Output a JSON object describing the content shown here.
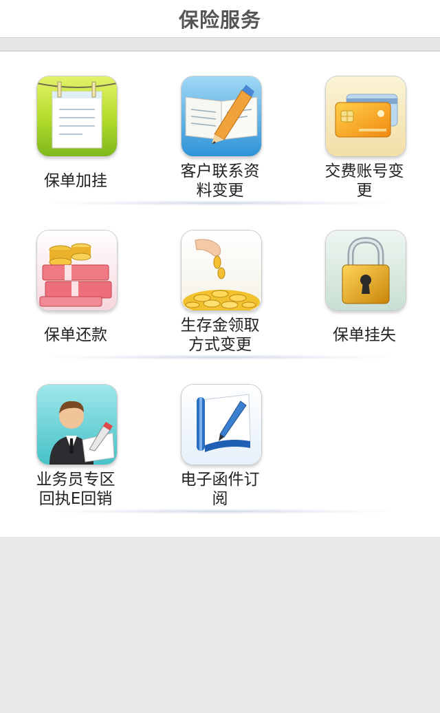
{
  "header": {
    "title": "保险服务"
  },
  "services": [
    {
      "label_lines": [
        "保单加挂"
      ],
      "icon": "notepad-icon"
    },
    {
      "label_lines": [
        "客户联系资",
        "料变更"
      ],
      "icon": "notebook-pencil-icon"
    },
    {
      "label_lines": [
        "交费账号变",
        "更"
      ],
      "icon": "bank-card-icon"
    },
    {
      "label_lines": [
        "保单还款"
      ],
      "icon": "money-coins-icon"
    },
    {
      "label_lines": [
        "生存金领取",
        "方式变更"
      ],
      "icon": "gold-coins-hand-icon"
    },
    {
      "label_lines": [
        "保单挂失"
      ],
      "icon": "padlock-icon"
    },
    {
      "label_lines": [
        "业务员专区",
        "回执E回销"
      ],
      "icon": "agent-avatar-icon"
    },
    {
      "label_lines": [
        "电子函件订",
        "阅"
      ],
      "icon": "document-pen-icon"
    }
  ],
  "colors": {
    "header_bg": "#ffffff",
    "title_text": "#555555",
    "page_bg": "#e8e8e8",
    "panel_bg": "#ffffff",
    "label_text": "#222222"
  }
}
